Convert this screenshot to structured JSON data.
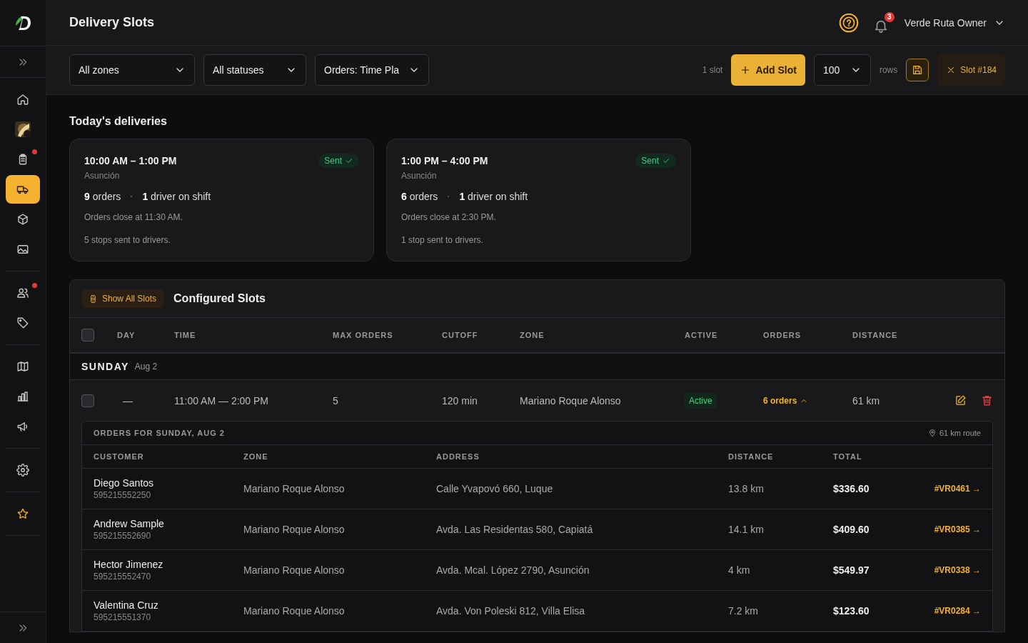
{
  "header": {
    "title": "Delivery Slots",
    "notifications": "3",
    "user": "Verde Ruta Owner"
  },
  "sidebar": {
    "groups": [
      {
        "items": [
          {
            "kind": "icon",
            "selected": false,
            "dot": false
          },
          {
            "kind": "picture",
            "selected": false,
            "dot": false
          },
          {
            "kind": "icon",
            "selected": false,
            "dot": true
          },
          {
            "kind": "icon",
            "selected": true,
            "dot": false
          },
          {
            "kind": "icon",
            "selected": false,
            "dot": false
          },
          {
            "kind": "icon",
            "selected": false,
            "dot": false
          }
        ]
      },
      {
        "items": [
          {
            "kind": "icon",
            "selected": false,
            "dot": true
          },
          {
            "kind": "icon",
            "selected": false,
            "dot": false
          }
        ]
      },
      {
        "items": [
          {
            "kind": "icon",
            "selected": false,
            "dot": false
          },
          {
            "kind": "icon",
            "selected": false,
            "dot": false
          },
          {
            "kind": "icon",
            "selected": false,
            "dot": false
          }
        ]
      },
      {
        "items": [
          {
            "kind": "icon",
            "selected": false,
            "dot": false
          }
        ]
      },
      {
        "items": [
          {
            "kind": "icon",
            "selected": false,
            "dot": false
          }
        ]
      }
    ]
  },
  "filters": [
    {
      "value": "All zones"
    },
    {
      "value": "All statuses"
    },
    {
      "value": "Orders: Time Pla"
    }
  ],
  "toolbar": {
    "count": "1 slot",
    "add_button": "Add Slot",
    "rows_value": "100",
    "rows_label": "rows",
    "chip": "Slot #184"
  },
  "today": {
    "title": "Today's deliveries",
    "cards": [
      {
        "time": "10:00 AM – 1:00 PM",
        "zone": "Asunción",
        "status": "Sent",
        "orders_count": "9",
        "orders_label": "orders",
        "drivers_count": "1",
        "drivers_label": "driver on shift",
        "close_note": "Orders close at 11:30 AM.",
        "stops_note": "5 stops sent to drivers."
      },
      {
        "time": "1:00 PM – 4:00 PM",
        "zone": "Asunción",
        "status": "Sent",
        "orders_count": "6",
        "orders_label": "orders",
        "drivers_count": "1",
        "drivers_label": "driver on shift",
        "close_note": "Orders close at 2:30 PM.",
        "stops_note": "1 stop sent to drivers."
      }
    ]
  },
  "slots": {
    "toggle": "Show All Slots",
    "title": "Configured Slots",
    "all_checked": false,
    "columns": [
      "DAY",
      "TIME",
      "MAX ORDERS",
      "CUTOFF",
      "ZONE",
      "ACTIVE",
      "ORDERS",
      "DISTANCE"
    ],
    "groups": [
      {
        "day": "SUNDAY",
        "date": "Aug 2",
        "rows": [
          {
            "checked": false,
            "day": "—",
            "time": "11:00 AM — 2:00 PM",
            "max_orders": "5",
            "cutoff": "120 min",
            "zone": "Mariano Roque Alonso",
            "active": true,
            "active_label": "Active",
            "orders": "6 orders",
            "expanded": true,
            "distance": "61 km",
            "orders_panel": {
              "title": "ORDERS FOR SUNDAY, AUG 2",
              "route": "61 km route",
              "columns": [
                "CUSTOMER",
                "ZONE",
                "ADDRESS",
                "DISTANCE",
                "TOTAL"
              ],
              "rows": [
                {
                  "name": "Diego Santos",
                  "phone": "595215552250",
                  "zone": "Mariano Roque Alonso",
                  "address": "Calle Yvapovó 660, Luque",
                  "distance": "13.8 km",
                  "total": "$336.60",
                  "link": "#VR0461 →"
                },
                {
                  "name": "Andrew Sample",
                  "phone": "595215552690",
                  "zone": "Mariano Roque Alonso",
                  "address": "Avda. Las Residentas 580, Capiatá",
                  "distance": "14.1 km",
                  "total": "$409.60",
                  "link": "#VR0385 →"
                },
                {
                  "name": "Hector Jimenez",
                  "phone": "595215552470",
                  "zone": "Mariano Roque Alonso",
                  "address": "Avda. Mcal. López 2790, Asunción",
                  "distance": "4 km",
                  "total": "$549.97",
                  "link": "#VR0338 →"
                },
                {
                  "name": "Valentina Cruz",
                  "phone": "595215551370",
                  "zone": "Mariano Roque Alonso",
                  "address": "Avda. Von Poleski 812, Villa Elisa",
                  "distance": "7.2 km",
                  "total": "$123.60",
                  "link": "#VR0284 →"
                }
              ]
            }
          }
        ]
      }
    ]
  }
}
